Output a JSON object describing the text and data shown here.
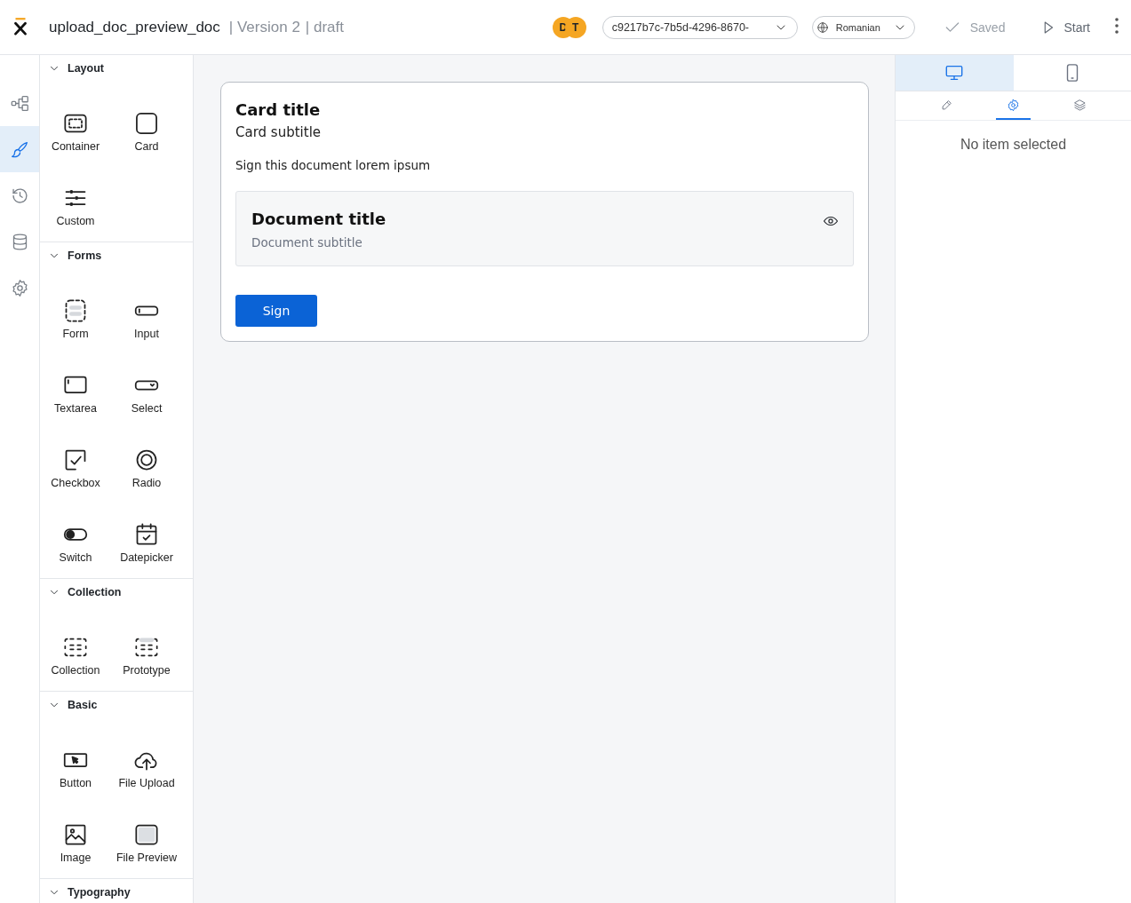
{
  "header": {
    "app_name": "upload_doc_preview_doc",
    "version": "| Version 2",
    "status": "| draft",
    "avatars": [
      {
        "initial": "D"
      },
      {
        "initial": "T"
      }
    ],
    "id_select": {
      "value": "c9217b7c-7b5d-4296-8670-"
    },
    "language_select": {
      "value": "Romanian"
    },
    "save_state": "Saved",
    "start_button": "Start"
  },
  "rail": [
    {
      "kind": "flow",
      "selected": false
    },
    {
      "kind": "brush",
      "selected": true
    },
    {
      "kind": "history",
      "selected": false
    },
    {
      "kind": "database",
      "selected": false
    },
    {
      "kind": "settings",
      "selected": false
    }
  ],
  "palette": [
    {
      "title": "Layout",
      "expanded": true,
      "items": [
        {
          "kind": "container",
          "label": "Container"
        },
        {
          "kind": "card",
          "label": "Card"
        },
        {
          "kind": "custom",
          "label": "Custom"
        }
      ]
    },
    {
      "title": "Forms",
      "expanded": true,
      "items": [
        {
          "kind": "form",
          "label": "Form"
        },
        {
          "kind": "input",
          "label": "Input"
        },
        {
          "kind": "textarea",
          "label": "Textarea"
        },
        {
          "kind": "select",
          "label": "Select"
        },
        {
          "kind": "checkbox",
          "label": "Checkbox"
        },
        {
          "kind": "radio",
          "label": "Radio"
        },
        {
          "kind": "switch",
          "label": "Switch"
        },
        {
          "kind": "datepicker",
          "label": "Datepicker"
        }
      ]
    },
    {
      "title": "Collection",
      "expanded": true,
      "items": [
        {
          "kind": "collection",
          "label": "Collection"
        },
        {
          "kind": "prototype",
          "label": "Prototype"
        }
      ]
    },
    {
      "title": "Basic",
      "expanded": true,
      "items": [
        {
          "kind": "button",
          "label": "Button"
        },
        {
          "kind": "upload",
          "label": "File Upload"
        },
        {
          "kind": "image",
          "label": "Image"
        },
        {
          "kind": "preview",
          "label": "File Preview"
        }
      ]
    },
    {
      "title": "Typography",
      "expanded": true
    }
  ],
  "canvas": {
    "card": {
      "title": "Card title",
      "subtitle": "Card subtitle",
      "text": "Sign this document lorem ipsum",
      "document": {
        "title": "Document title",
        "subtitle": "Document subtitle"
      },
      "button": "Sign"
    }
  },
  "properties": {
    "device_tabs": [
      {
        "kind": "desktop",
        "selected": true
      },
      {
        "kind": "mobile",
        "selected": false
      }
    ],
    "panel_tabs": [
      {
        "kind": "edit",
        "selected": false
      },
      {
        "kind": "settings",
        "selected": true
      },
      {
        "kind": "layers",
        "selected": false
      }
    ],
    "empty_message": "No item selected"
  }
}
